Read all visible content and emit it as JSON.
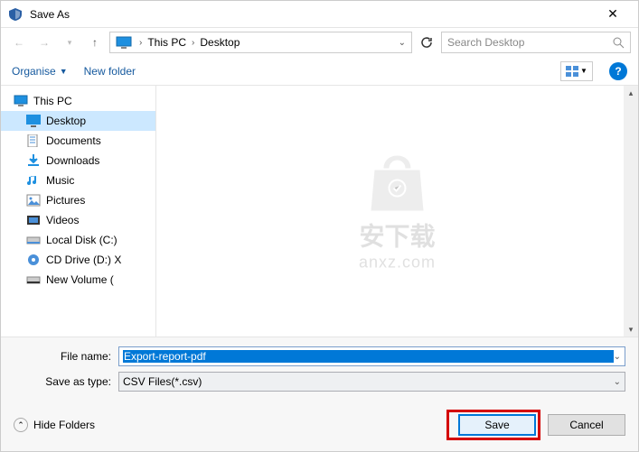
{
  "title": "Save As",
  "breadcrumb": {
    "root": "This PC",
    "current": "Desktop"
  },
  "search": {
    "placeholder": "Search Desktop"
  },
  "toolbar": {
    "organise": "Organise",
    "newfolder": "New folder"
  },
  "tree": {
    "root": "This PC",
    "items": [
      {
        "label": "Desktop"
      },
      {
        "label": "Documents"
      },
      {
        "label": "Downloads"
      },
      {
        "label": "Music"
      },
      {
        "label": "Pictures"
      },
      {
        "label": "Videos"
      },
      {
        "label": "Local Disk (C:)"
      },
      {
        "label": "CD Drive (D:) X"
      },
      {
        "label": "New Volume ("
      }
    ]
  },
  "watermark": {
    "line1": "安下载",
    "line2": "anxz.com"
  },
  "fields": {
    "filename_label": "File name:",
    "filename_value": "Export-report-pdf",
    "type_label": "Save as type:",
    "type_value": "CSV Files(*.csv)"
  },
  "footer": {
    "hide": "Hide Folders",
    "save": "Save",
    "cancel": "Cancel"
  }
}
